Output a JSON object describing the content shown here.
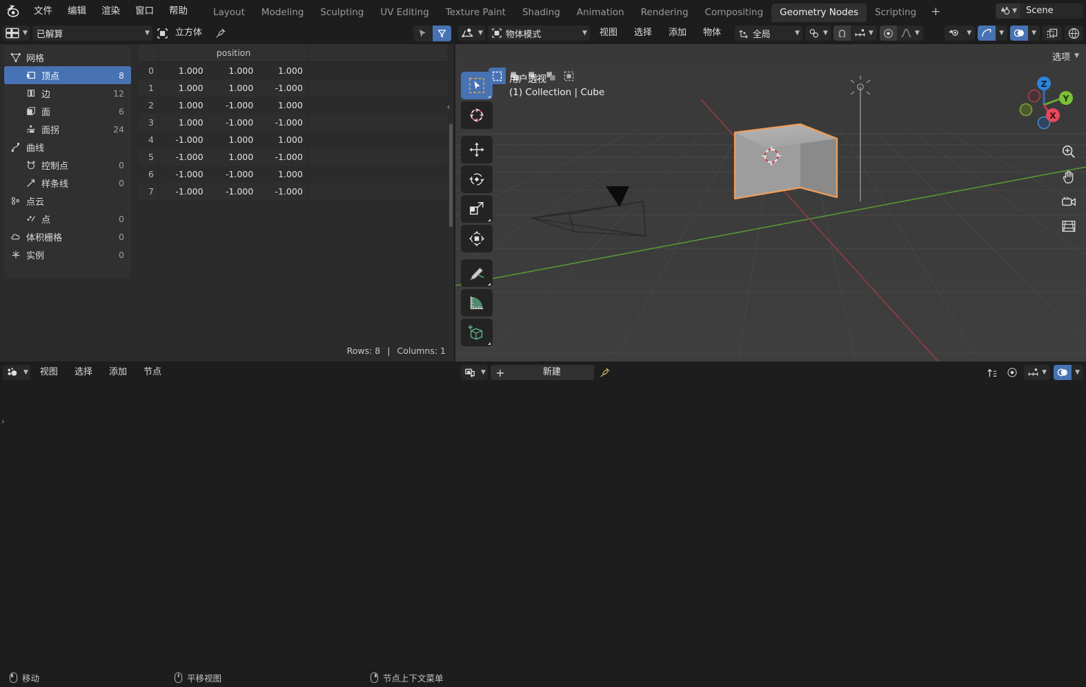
{
  "app": {
    "logo": "blender-logo",
    "menus": [
      "文件",
      "编辑",
      "渲染",
      "窗口",
      "帮助"
    ],
    "workspaces": [
      {
        "label": "Layout",
        "active": false
      },
      {
        "label": "Modeling",
        "active": false
      },
      {
        "label": "Sculpting",
        "active": false
      },
      {
        "label": "UV Editing",
        "active": false
      },
      {
        "label": "Texture Paint",
        "active": false
      },
      {
        "label": "Shading",
        "active": false
      },
      {
        "label": "Animation",
        "active": false
      },
      {
        "label": "Rendering",
        "active": false
      },
      {
        "label": "Compositing",
        "active": false
      },
      {
        "label": "Geometry Nodes",
        "active": true
      },
      {
        "label": "Scripting",
        "active": false
      }
    ],
    "add_workspace": "+",
    "scene": {
      "name": "Scene",
      "icon": "scene-icon"
    },
    "accent": "#4772b3"
  },
  "spreadsheet": {
    "header": {
      "editor_type_icon": "spreadsheet-editor-icon",
      "dataset_label": "已解算",
      "object_icon": "object-icon",
      "object_name": "立方体",
      "pin_icon": "pin-icon",
      "cursor_filter_icon": "cursor-filter-icon",
      "filter_icon": "filter-icon"
    },
    "tree": [
      {
        "label": "网格",
        "count": "",
        "icon": "mesh-icon",
        "child": false,
        "selected": false
      },
      {
        "label": "顶点",
        "count": "8",
        "icon": "vertex-icon",
        "child": true,
        "selected": true
      },
      {
        "label": "边",
        "count": "12",
        "icon": "edge-icon",
        "child": true,
        "selected": false
      },
      {
        "label": "面",
        "count": "6",
        "icon": "face-icon",
        "child": true,
        "selected": false
      },
      {
        "label": "面拐",
        "count": "24",
        "icon": "face-corner-icon",
        "child": true,
        "selected": false
      },
      {
        "label": "曲线",
        "count": "",
        "icon": "curve-icon",
        "child": false,
        "selected": false
      },
      {
        "label": "控制点",
        "count": "0",
        "icon": "control-point-icon",
        "child": true,
        "selected": false
      },
      {
        "label": "样条线",
        "count": "0",
        "icon": "spline-icon",
        "child": true,
        "selected": false
      },
      {
        "label": "点云",
        "count": "",
        "icon": "pointcloud-icon",
        "child": false,
        "selected": false
      },
      {
        "label": "点",
        "count": "0",
        "icon": "point-icon",
        "child": true,
        "selected": false
      },
      {
        "label": "体积栅格",
        "count": "0",
        "icon": "volume-grid-icon",
        "child": false,
        "selected": false
      },
      {
        "label": "实例",
        "count": "0",
        "icon": "instances-icon",
        "child": false,
        "selected": false
      }
    ],
    "table": {
      "column_group": "position",
      "rows": [
        {
          "index": "0",
          "values": [
            "1.000",
            "1.000",
            "1.000"
          ]
        },
        {
          "index": "1",
          "values": [
            "1.000",
            "1.000",
            "-1.000"
          ]
        },
        {
          "index": "2",
          "values": [
            "1.000",
            "-1.000",
            "1.000"
          ]
        },
        {
          "index": "3",
          "values": [
            "1.000",
            "-1.000",
            "-1.000"
          ]
        },
        {
          "index": "4",
          "values": [
            "-1.000",
            "1.000",
            "1.000"
          ]
        },
        {
          "index": "5",
          "values": [
            "-1.000",
            "1.000",
            "-1.000"
          ]
        },
        {
          "index": "6",
          "values": [
            "-1.000",
            "-1.000",
            "1.000"
          ]
        },
        {
          "index": "7",
          "values": [
            "-1.000",
            "-1.000",
            "-1.000"
          ]
        }
      ]
    },
    "footer": {
      "rows": "Rows: 8",
      "separator": "|",
      "columns": "Columns: 1"
    }
  },
  "viewport": {
    "header": {
      "editor_type_icon": "viewport-editor-icon",
      "mode_icon": "object-mode-icon",
      "mode_label": "物体模式",
      "menus": [
        "视图",
        "选择",
        "添加",
        "物体"
      ],
      "orientation_icon": "transform-orientation-icon",
      "orientation_label": "全局",
      "pivot_icon": "pivot-icon",
      "snap_magnet_icon": "magnet-icon",
      "snap_icon": "snap-increment-icon",
      "proportional_icon": "proportional-edit-icon",
      "falloff_icon": "falloff-curve-icon",
      "visibility_icon": "visibility-icon",
      "gizmo_icon": "gizmo-icon",
      "overlay_icon": "overlays-icon",
      "xray_icon": "xray-icon",
      "shading_icon": "shading-solid-icon"
    },
    "select_modes": [
      "select-box-icon",
      "select-extend-icon",
      "select-subtract-icon",
      "select-invert-icon",
      "select-intersect-icon"
    ],
    "options_label": "选项",
    "tools": [
      {
        "icon": "tweak-select-box-icon",
        "active": true,
        "corner": true
      },
      {
        "icon": "cursor-icon",
        "active": false,
        "corner": false
      },
      {
        "icon": "move-icon",
        "active": false,
        "corner": false
      },
      {
        "icon": "rotate-icon",
        "active": false,
        "corner": false
      },
      {
        "icon": "scale-icon",
        "active": false,
        "corner": true
      },
      {
        "icon": "transform-icon",
        "active": false,
        "corner": false
      },
      {
        "icon": "annotate-icon",
        "active": false,
        "corner": true
      },
      {
        "icon": "measure-icon",
        "active": false,
        "corner": false
      },
      {
        "icon": "add-cube-icon",
        "active": false,
        "corner": true
      }
    ],
    "overlay_text": {
      "line1": "用户透视",
      "line2": "(1) Collection | Cube"
    },
    "gizmo": {
      "x": "X",
      "y": "Y",
      "z": "Z"
    },
    "right_buttons": [
      "zoom-icon",
      "pan-hand-icon",
      "camera-icon",
      "ortho-persp-icon"
    ],
    "selected_object_outline": "#ed9e5c"
  },
  "node_editor": {
    "header": {
      "editor_type_icon": "geometry-nodes-editor-icon",
      "menus": [
        "视图",
        "选择",
        "添加",
        "节点"
      ],
      "datablock_icon": "node-tree-icon",
      "add_new_icon": "+",
      "new_label": "新建",
      "pin_icon": "pin-icon",
      "snap_icon": "snap-icon",
      "overlay_arrow_icon": "node-options-icon",
      "proportional_icon": "proportional-icon",
      "overlays_icon": "overlays-icon"
    },
    "sidebar_arrow": "›"
  },
  "statusbar": {
    "items": [
      {
        "mouse": "left",
        "label": "移动"
      },
      {
        "mouse": "mid",
        "label": "平移视图"
      },
      {
        "mouse": "right",
        "label": "节点上下文菜单"
      }
    ]
  }
}
